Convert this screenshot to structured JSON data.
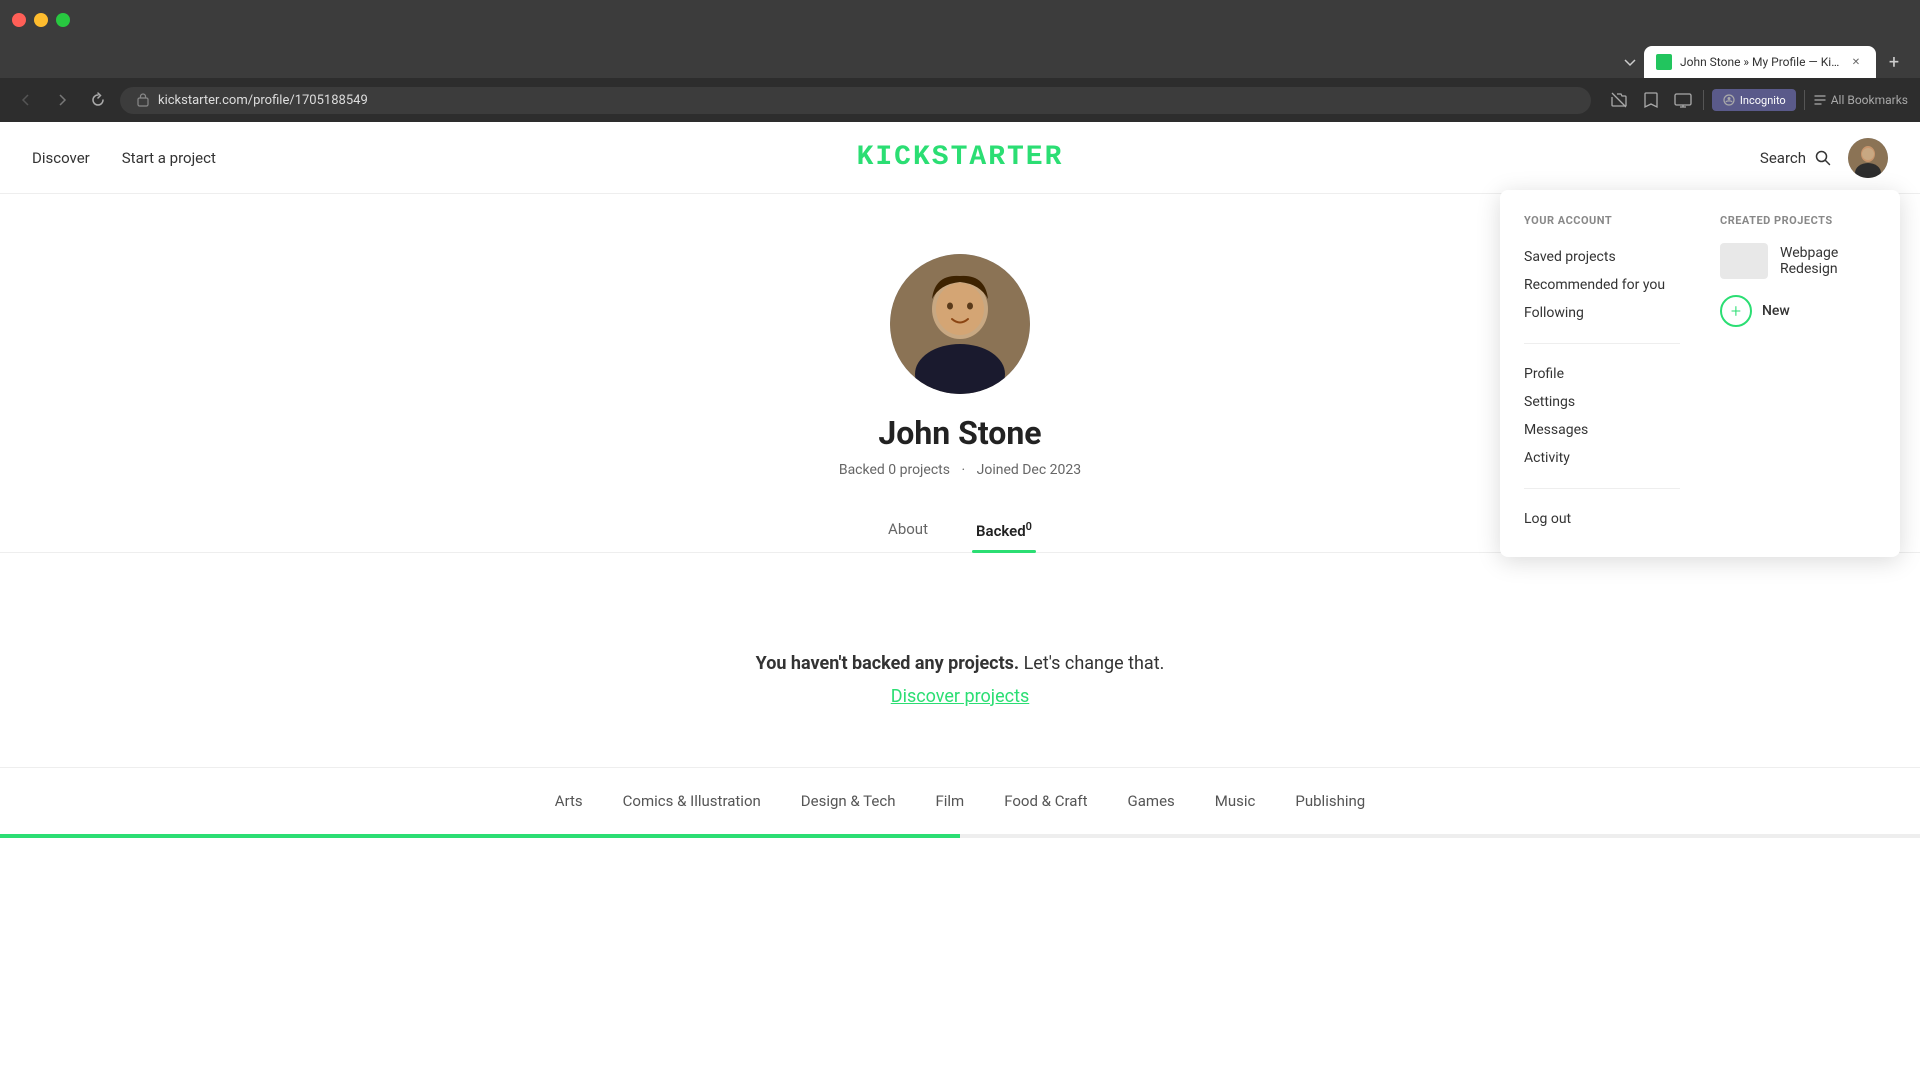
{
  "browser": {
    "tab_title": "John Stone » My Profile — Kick",
    "url": "kickstarter.com/profile/1705188549",
    "new_tab_label": "+",
    "back_title": "←",
    "forward_title": "→",
    "refresh_title": "↻",
    "incognito_label": "Incognito",
    "bookmarks_label": "All Bookmarks"
  },
  "nav": {
    "discover_label": "Discover",
    "start_project_label": "Start a project",
    "logo_text": "KICKSTARTER",
    "search_label": "Search"
  },
  "profile": {
    "name": "John Stone",
    "backed_count": "0",
    "backed_label": "Backed 0 projects",
    "dot": "·",
    "joined_label": "Joined Dec 2023",
    "tab_about": "About",
    "tab_backed": "Backed",
    "tab_backed_count": "0",
    "no_backed_text": "You haven't backed any projects.",
    "change_text": "Let's change that.",
    "discover_projects_link": "Discover projects"
  },
  "dropdown": {
    "your_account_title": "YOUR ACCOUNT",
    "created_projects_title": "CREATED PROJECTS",
    "saved_projects_label": "Saved projects",
    "recommended_label": "Recommended for you",
    "following_label": "Following",
    "profile_label": "Profile",
    "settings_label": "Settings",
    "messages_label": "Messages",
    "activity_label": "Activity",
    "logout_label": "Log out",
    "project_name": "Webpage Redesign",
    "new_label": "New"
  },
  "footer": {
    "categories": [
      {
        "label": "Arts",
        "id": "arts"
      },
      {
        "label": "Comics & Illustration",
        "id": "comics"
      },
      {
        "label": "Design & Tech",
        "id": "design"
      },
      {
        "label": "Film",
        "id": "film"
      },
      {
        "label": "Food & Craft",
        "id": "food"
      },
      {
        "label": "Games",
        "id": "games"
      },
      {
        "label": "Music",
        "id": "music"
      },
      {
        "label": "Publishing",
        "id": "publishing"
      }
    ]
  }
}
